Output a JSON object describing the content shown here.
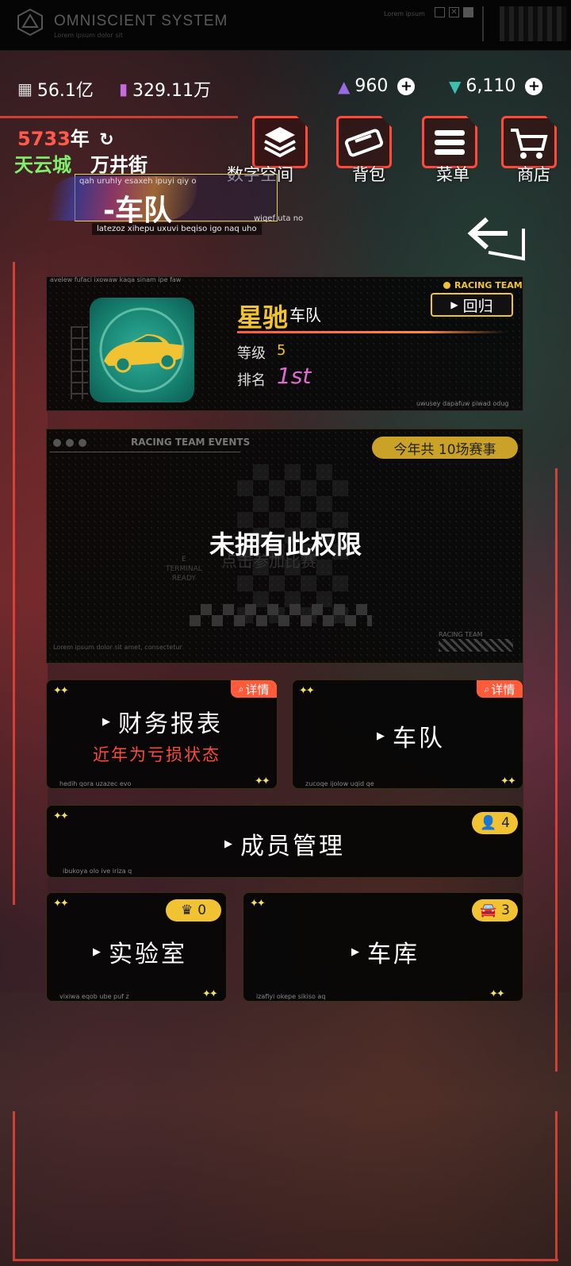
{
  "system": {
    "title": "OMNISCIENT  SYSTEM",
    "subtitle": "Lorem ipsum dolor sit",
    "top_lorem": "Lorem ipsum"
  },
  "resources": {
    "coins": "56.1亿",
    "gems": "329.11万",
    "energy": "960",
    "diamonds": "6,110"
  },
  "location": {
    "year_num": "5733",
    "year_unit": "年",
    "city": "天云城",
    "street": "万井街"
  },
  "nav_buttons": {
    "digital_space": "数字空间",
    "backpack": "背包",
    "menu": "菜单",
    "shop": "商店"
  },
  "banner": {
    "top_text": "qah uruhly esaxeh ipuyi qiy o",
    "title": "-车队",
    "right_text": "wiqef uta no",
    "sub_text": "latezoz xihepu uxuvi beqiso igo naq uho"
  },
  "team_card": {
    "top_lorem": "avelew fufaci ixowaw kaqa sinam ipe faw",
    "badge": "RACING TEAM",
    "name": "星驰",
    "name_suffix": "车队",
    "level_label": "等级",
    "level": "5",
    "rank_label": "排名",
    "rank": "1st",
    "return_label": "回归",
    "bottom_lorem": "uwusey dapafuw piwad odug"
  },
  "events_card": {
    "title": "RACING TEAM EVENTS",
    "count_label": "今年共 10场赛事",
    "locked_text": "未拥有此权限",
    "ghost_text": "点击参加比赛",
    "term_text": "E\nTERMINAL\nREADY",
    "bottom_lorem": "Lorem ipsum dolor sit amet, consectetur",
    "corner_label": "RACING TEAM"
  },
  "menu": {
    "finance": {
      "label": "财务报表",
      "warning": "近年为亏损状态",
      "detail": "详情",
      "lorem": "hedih qora uzazec evo"
    },
    "team": {
      "label": "车队",
      "detail": "详情",
      "lorem": "zucoqe ijolow uqid qe"
    },
    "members": {
      "label": "成员管理",
      "count": "4",
      "lorem": "ibukoya olo ive iriza q"
    },
    "lab": {
      "label": "实验室",
      "count": "0",
      "lorem": "vixiwa eqob ube puf z"
    },
    "garage": {
      "label": "车库",
      "count": "3",
      "lorem": "izafiyi okepe sikiso aq"
    }
  },
  "colors": {
    "accent_red": "#ff4a3a",
    "accent_gold": "#f1c232",
    "city_green": "#7ef06a",
    "rank_pink": "#e06ad0"
  }
}
